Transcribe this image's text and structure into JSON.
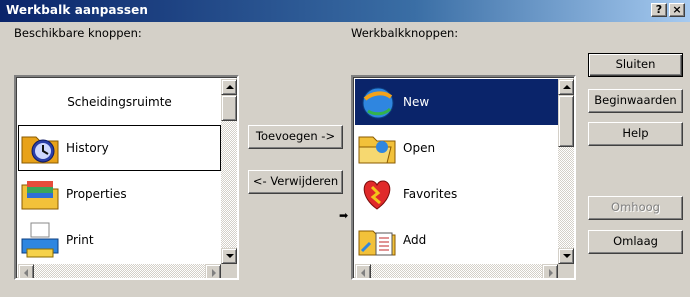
{
  "window": {
    "title": "Werkbalk aanpassen",
    "help_glyph": "?",
    "close_glyph": "×"
  },
  "available": {
    "label": "Beschikbare knoppen:",
    "items": [
      {
        "label": "Scheidingsruimte",
        "icon": "separator"
      },
      {
        "label": "History",
        "icon": "history-icon"
      },
      {
        "label": "Properties",
        "icon": "properties-icon"
      },
      {
        "label": "Print",
        "icon": "print-icon"
      }
    ]
  },
  "current": {
    "label": "Werkbalkknoppen:",
    "items": [
      {
        "label": "New",
        "icon": "new-icon"
      },
      {
        "label": "Open",
        "icon": "open-icon"
      },
      {
        "label": "Favorites",
        "icon": "favorites-icon"
      },
      {
        "label": "Add",
        "icon": "add-icon"
      }
    ]
  },
  "buttons": {
    "add": "Toevoegen ->",
    "remove": "<- Verwijderen",
    "close": "Sluiten",
    "reset": "Beginwaarden",
    "help": "Help",
    "up": "Omhoog",
    "down": "Omlaag"
  },
  "insert_marker": "➡"
}
